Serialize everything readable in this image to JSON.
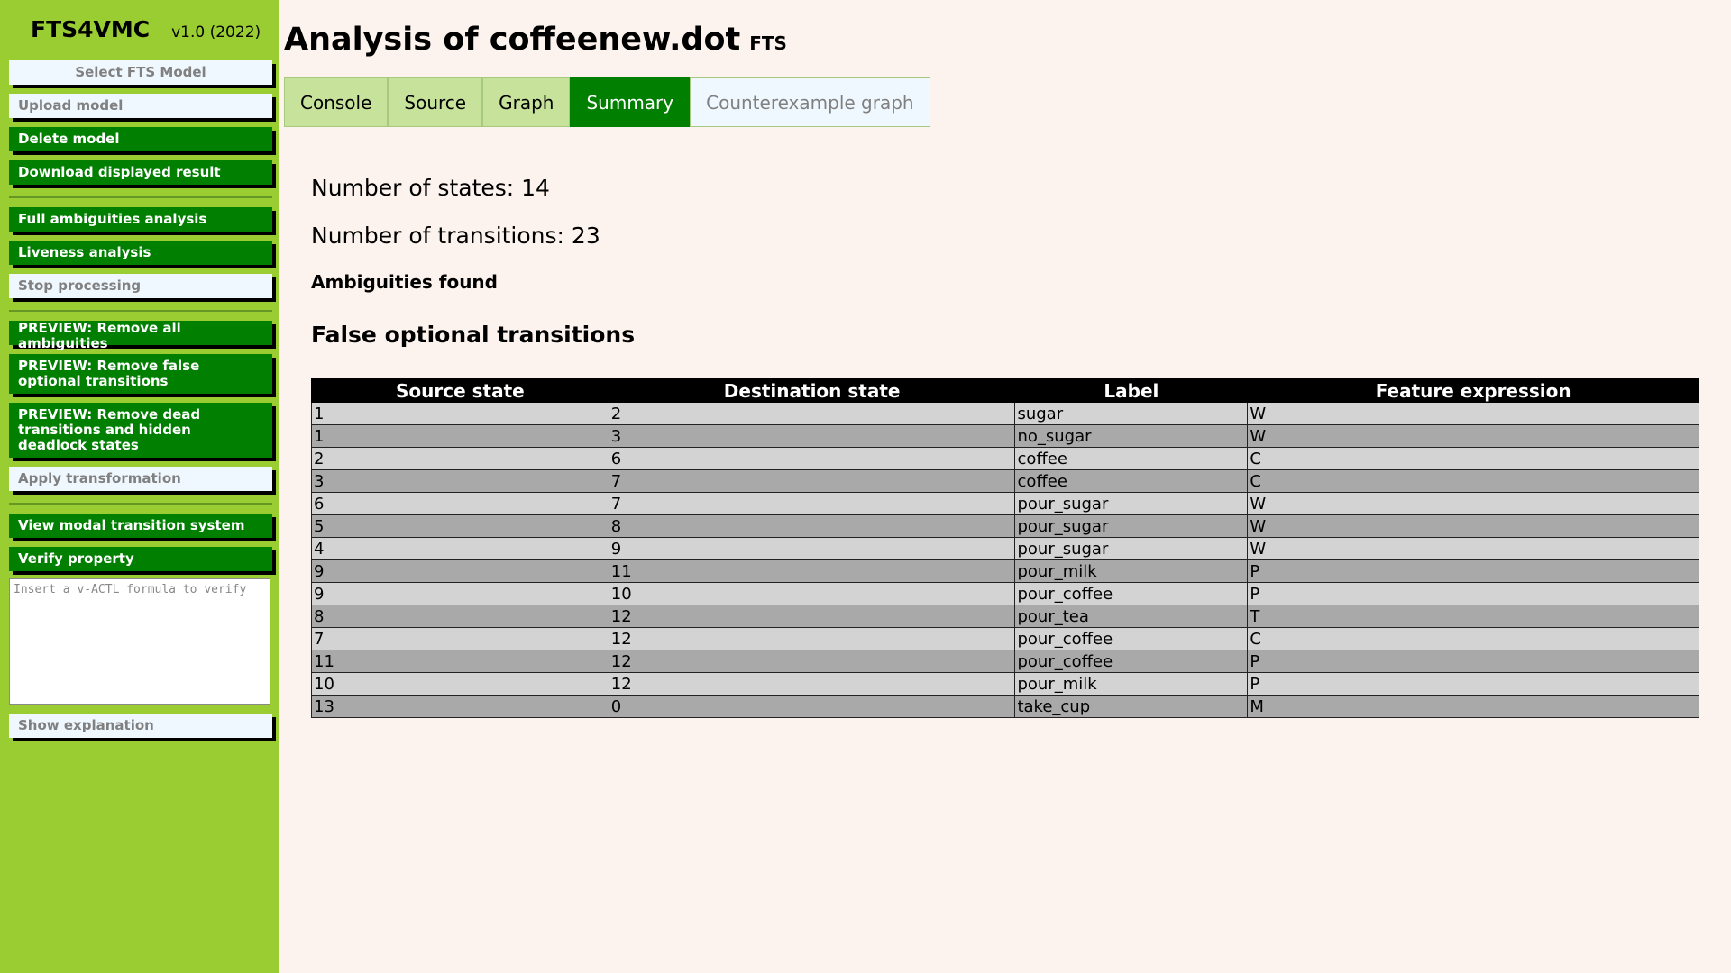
{
  "brand": {
    "name": "FTS4VMC",
    "version": "v1.0 (2022)"
  },
  "sidebar": {
    "select_model": "Select FTS Model",
    "upload_model": "Upload model",
    "delete_model": "Delete model",
    "download_result": "Download displayed result",
    "full_ambiguities": "Full ambiguities analysis",
    "liveness": "Liveness analysis",
    "stop_processing": "Stop processing",
    "preview_remove_all": "PREVIEW: Remove all ambiguities",
    "preview_remove_false_optional": "PREVIEW: Remove false optional transitions",
    "preview_remove_dead": "PREVIEW: Remove dead transitions and hidden deadlock states",
    "apply_transformation": "Apply transformation",
    "view_mts": "View modal transition system",
    "verify_property": "Verify property",
    "formula_placeholder": "Insert a v-ACTL formula to verify",
    "show_explanation": "Show explanation"
  },
  "main": {
    "title": "Analysis of coffeenew.dot",
    "title_badge": "FTS",
    "tabs": [
      "Console",
      "Source",
      "Graph",
      "Summary",
      "Counterexample graph"
    ],
    "active_tab": "Summary",
    "states_text": "Number of states: 14",
    "transitions_text": "Number of transitions: 23",
    "ambiguities_heading": "Ambiguities found",
    "section_title": "False optional transitions",
    "table": {
      "headers": [
        "Source state",
        "Destination state",
        "Label",
        "Feature expression"
      ],
      "rows": [
        [
          "1",
          "2",
          "sugar",
          "W"
        ],
        [
          "1",
          "3",
          "no_sugar",
          "W"
        ],
        [
          "2",
          "6",
          "coffee",
          "C"
        ],
        [
          "3",
          "7",
          "coffee",
          "C"
        ],
        [
          "6",
          "7",
          "pour_sugar",
          "W"
        ],
        [
          "5",
          "8",
          "pour_sugar",
          "W"
        ],
        [
          "4",
          "9",
          "pour_sugar",
          "W"
        ],
        [
          "9",
          "11",
          "pour_milk",
          "P"
        ],
        [
          "9",
          "10",
          "pour_coffee",
          "P"
        ],
        [
          "8",
          "12",
          "pour_tea",
          "T"
        ],
        [
          "7",
          "12",
          "pour_coffee",
          "C"
        ],
        [
          "11",
          "12",
          "pour_coffee",
          "P"
        ],
        [
          "10",
          "12",
          "pour_milk",
          "P"
        ],
        [
          "13",
          "0",
          "take_cup",
          "M"
        ]
      ]
    }
  },
  "colors": {
    "sidebar_bg": "#9acd32",
    "button_green": "#007f00",
    "button_disabled": "#f0f8ff",
    "page_bg": "#fdf3ee",
    "row_light": "#d3d3d3",
    "row_dark": "#a9a9a9"
  }
}
